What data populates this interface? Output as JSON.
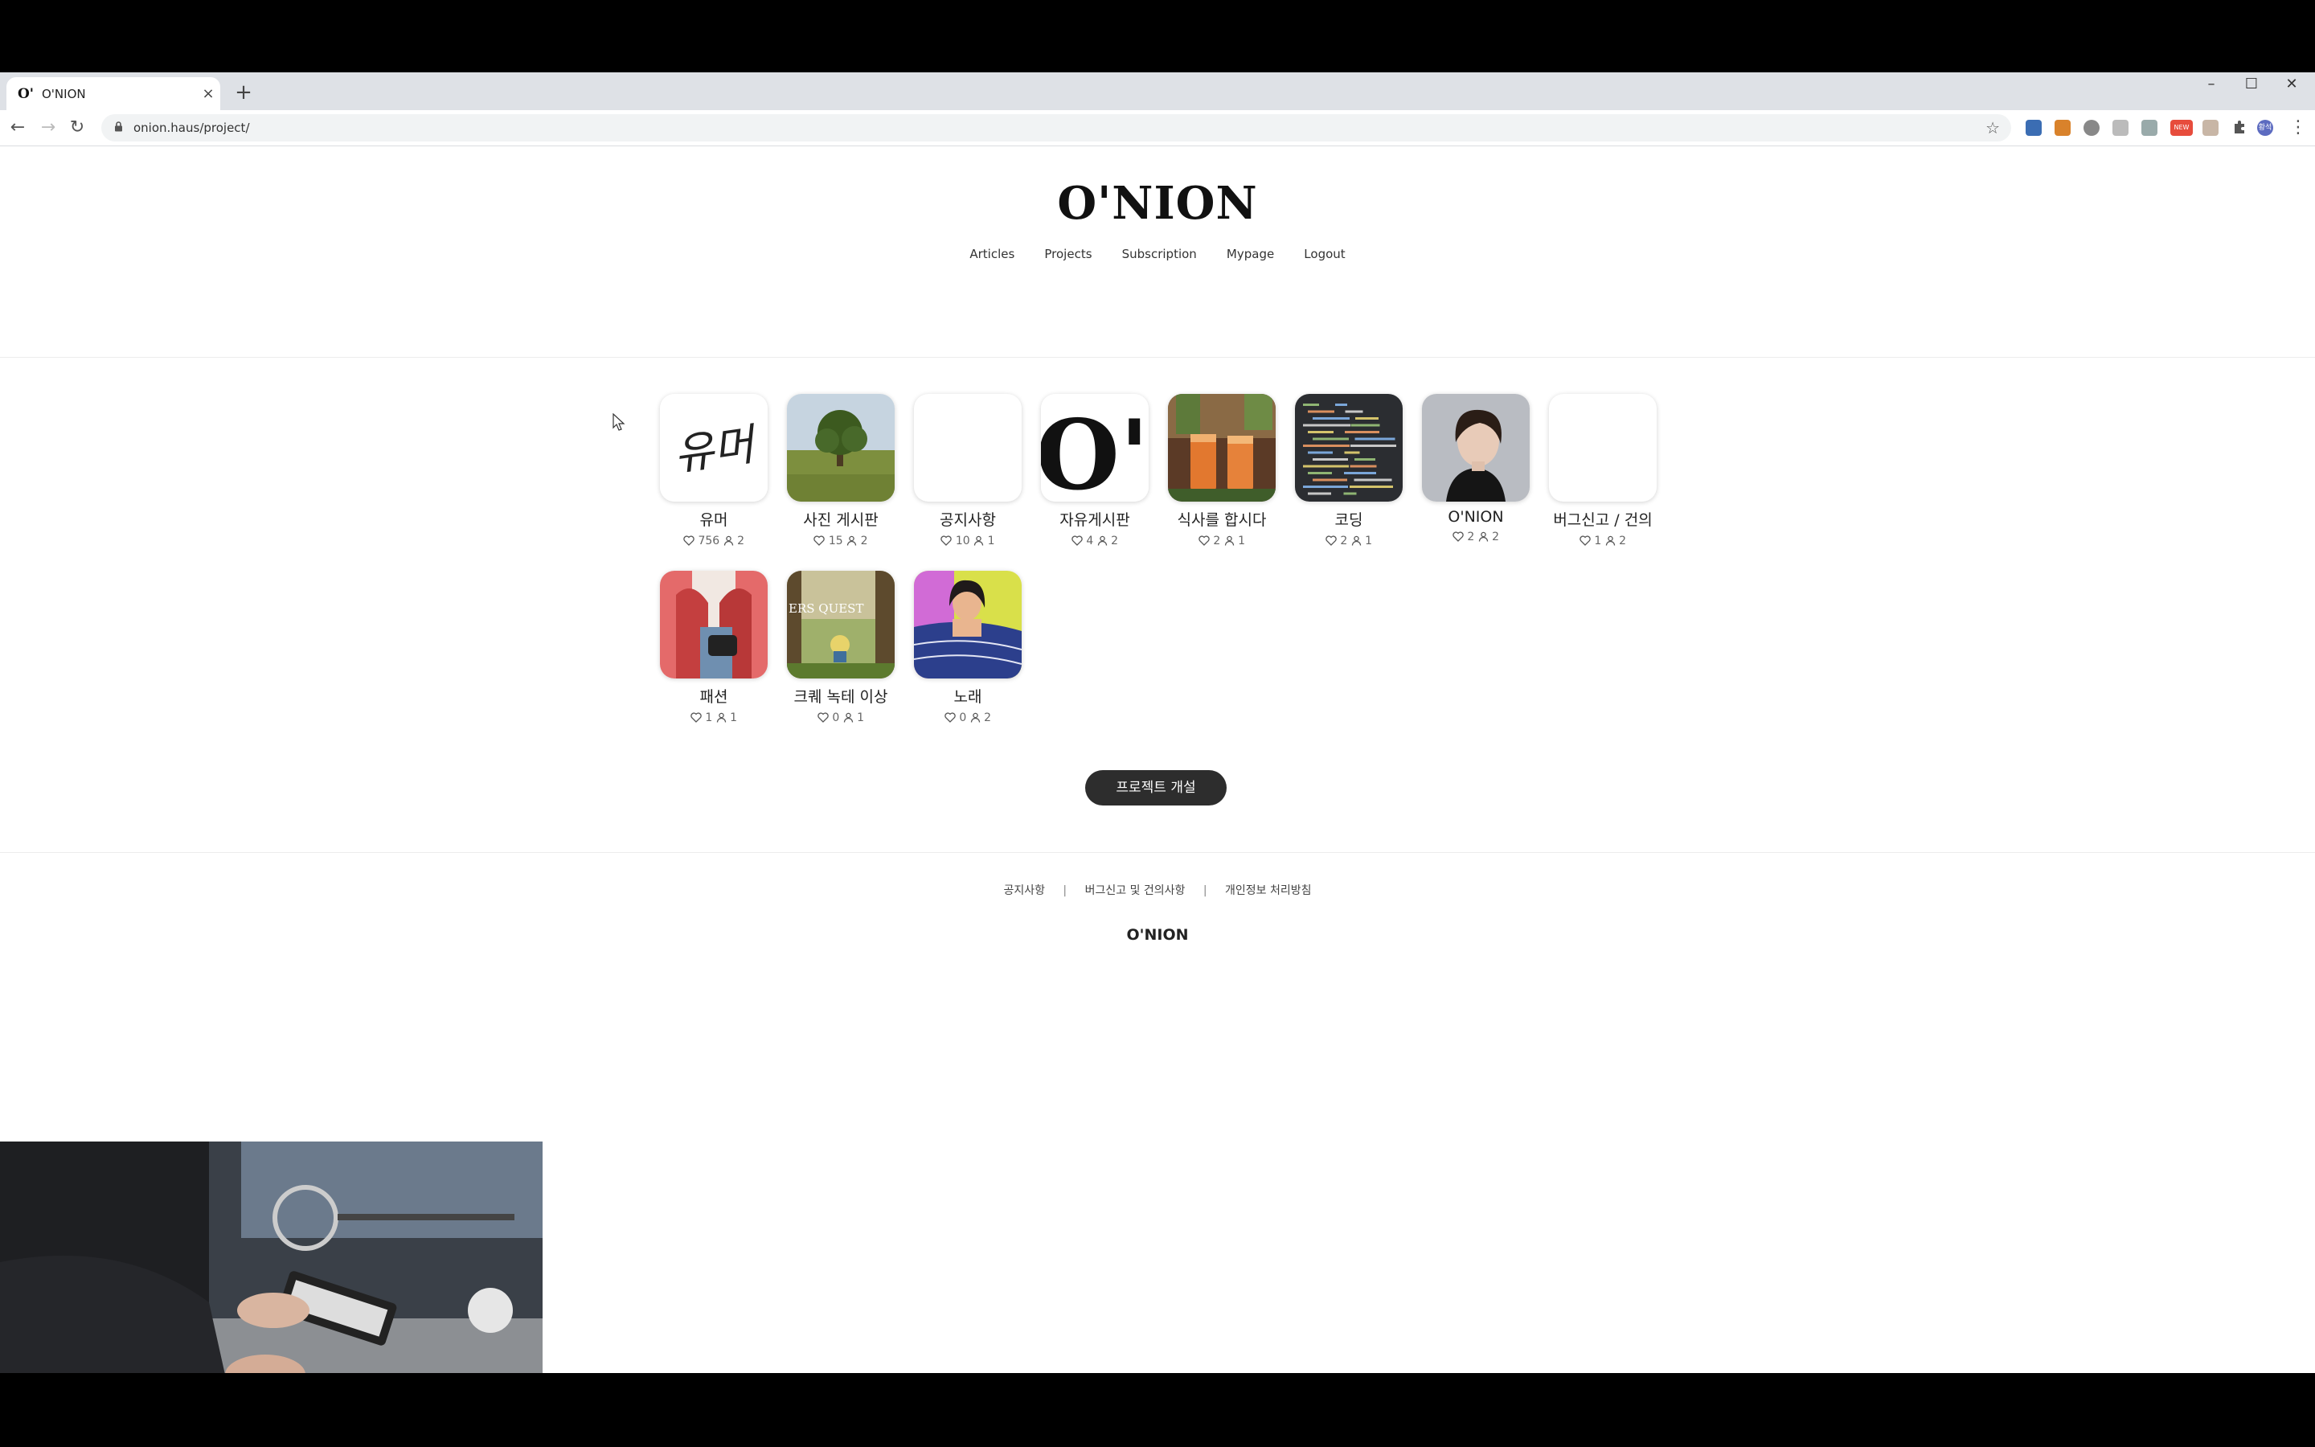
{
  "browser": {
    "tab_favicon": "O'",
    "tab_title": "O'NION",
    "tab_close": "×",
    "new_tab": "+",
    "url": "onion.haus/project/",
    "window_controls": [
      "–",
      "☐",
      "✕"
    ],
    "back_icon": "←",
    "forward_icon": "→",
    "reload_icon": "↻",
    "bookmark_icon": "☆",
    "extension_badge": "NEW",
    "profile_initials": "황석"
  },
  "site": {
    "logo": "O'NION",
    "nav": [
      "Articles",
      "Projects",
      "Subscription",
      "Mypage",
      "Logout"
    ]
  },
  "projects": [
    {
      "name": "유머",
      "likes": "756",
      "members": "2",
      "thumb": "humor-handwriting"
    },
    {
      "name": "사진 게시판",
      "likes": "15",
      "members": "2",
      "thumb": "tree-field-photo"
    },
    {
      "name": "공지사항",
      "likes": "10",
      "members": "1",
      "thumb": "blank"
    },
    {
      "name": "자유게시판",
      "likes": "4",
      "members": "2",
      "thumb": "onion-logo"
    },
    {
      "name": "식사를 합시다",
      "likes": "2",
      "members": "1",
      "thumb": "drinks-photo"
    },
    {
      "name": "코딩",
      "likes": "2",
      "members": "1",
      "thumb": "code-screen"
    },
    {
      "name": "O'NION",
      "likes": "2",
      "members": "2",
      "thumb": "portrait-photo"
    },
    {
      "name": "버그신고 / 건의",
      "likes": "1",
      "members": "2",
      "thumb": "blank"
    },
    {
      "name": "패션",
      "likes": "1",
      "members": "1",
      "thumb": "fashion-photo"
    },
    {
      "name": "크퀘 녹테 이상",
      "likes": "0",
      "members": "1",
      "thumb": "game-art"
    },
    {
      "name": "노래",
      "likes": "0",
      "members": "2",
      "thumb": "illustration-woman"
    }
  ],
  "humor_thumb_text": "유머",
  "onion_thumb_text": "O'",
  "game_thumb_text": "ERS QUEST",
  "create_button": "프로젝트 개설",
  "footer": {
    "links": [
      "공지사항",
      "버그신고 및 건의사항",
      "개인정보 처리방침"
    ],
    "separator": "|",
    "logo": "O'NION"
  },
  "colors": {
    "button_bg": "#2d2d2d",
    "tabstrip_bg": "#dee1e6",
    "urlbar_bg": "#f1f3f4"
  }
}
